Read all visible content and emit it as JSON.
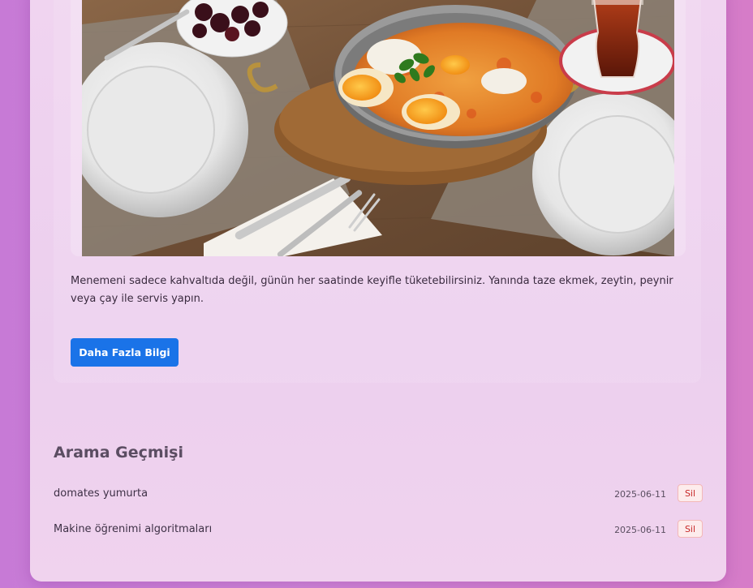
{
  "article": {
    "image_alt": "Menemen",
    "description": "Menemeni sadece kahvaltıda değil, günün her saatinde keyifle tüketebilirsiniz. Yanında taze ekmek, zeytin, peynir veya çay ile servis yapın.",
    "more_button_label": "Daha Fazla Bilgi"
  },
  "history": {
    "title": "Arama Geçmişi",
    "delete_label": "Sil",
    "items": [
      {
        "query": "domates yumurta",
        "date": "2025-06-11"
      },
      {
        "query": "Makine öğrenimi algoritmaları",
        "date": "2025-06-11"
      }
    ]
  },
  "colors": {
    "primary_button": "#1a73e8",
    "delete_text": "#c62828",
    "delete_bg": "#fdecec"
  }
}
